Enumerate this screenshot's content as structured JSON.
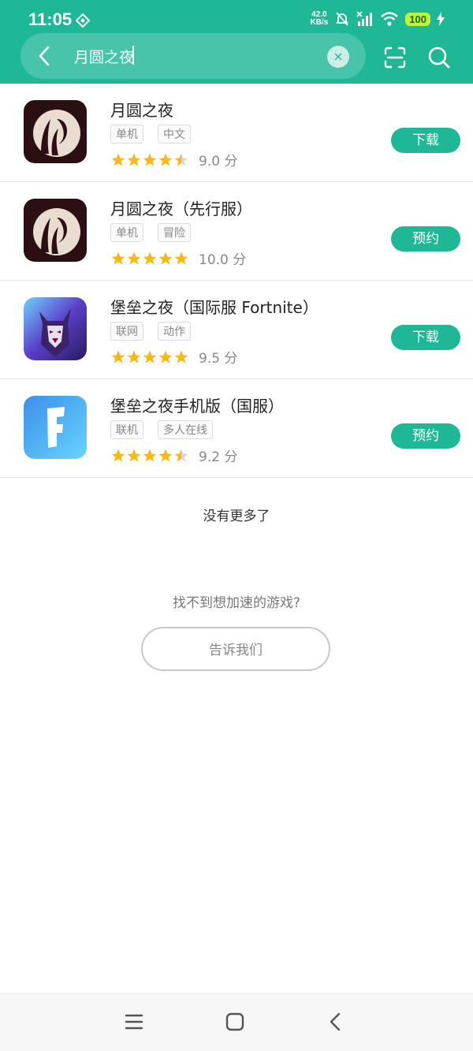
{
  "status_bar": {
    "time": "11:05",
    "net_speed_value": "42.0",
    "net_speed_unit": "KB/s",
    "battery": "100"
  },
  "search": {
    "query": "月圆之夜"
  },
  "games": [
    {
      "title": "月圆之夜",
      "tags": [
        "单机",
        "中文"
      ],
      "score": "9.0 分",
      "stars": 4.5,
      "action": "下载",
      "icon": "moon-night-icon"
    },
    {
      "title": "月圆之夜（先行服）",
      "tags": [
        "单机",
        "冒险"
      ],
      "score": "10.0 分",
      "stars": 5,
      "action": "预约",
      "icon": "moon-night-icon"
    },
    {
      "title": "堡垒之夜（国际服 Fortnite）",
      "tags": [
        "联网",
        "动作"
      ],
      "score": "9.5 分",
      "stars": 5,
      "action": "下载",
      "icon": "fortnite-character-icon"
    },
    {
      "title": "堡垒之夜手机版（国服）",
      "tags": [
        "联机",
        "多人在线"
      ],
      "score": "9.2 分",
      "stars": 4.5,
      "action": "预约",
      "icon": "fortnite-f-icon"
    }
  ],
  "footer": {
    "no_more": "没有更多了",
    "cant_find": "找不到想加速的游戏?",
    "tell_us": "告诉我们"
  },
  "colors": {
    "accent": "#1fb896",
    "star": "#f7b916",
    "star_empty": "#d8d8d8"
  }
}
